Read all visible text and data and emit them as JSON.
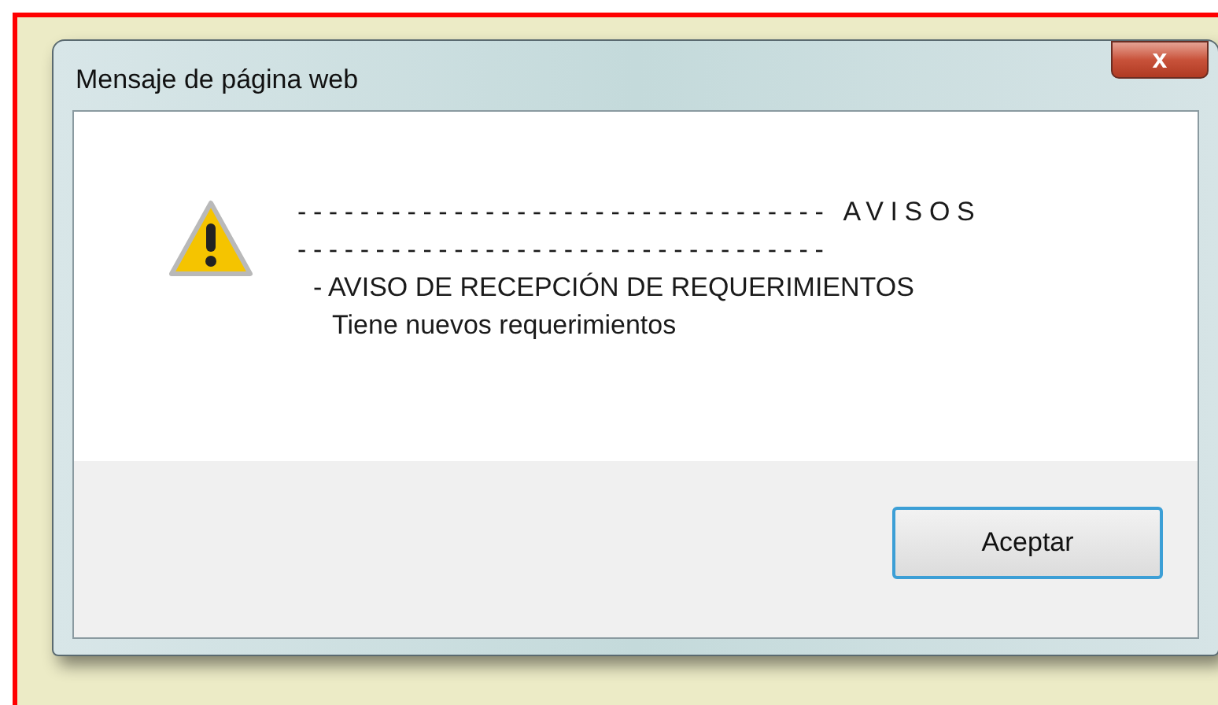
{
  "dialog": {
    "title": "Mensaje de página web",
    "close_label": "x",
    "message_lines": [
      "---------------------------------- AVISOS",
      "----------------------------------",
      "- AVISO DE RECEPCIÓN DE REQUERIMIENTOS",
      "Tiene nuevos requerimientos"
    ],
    "buttons": [
      {
        "label": "Aceptar",
        "selected": true
      }
    ]
  }
}
